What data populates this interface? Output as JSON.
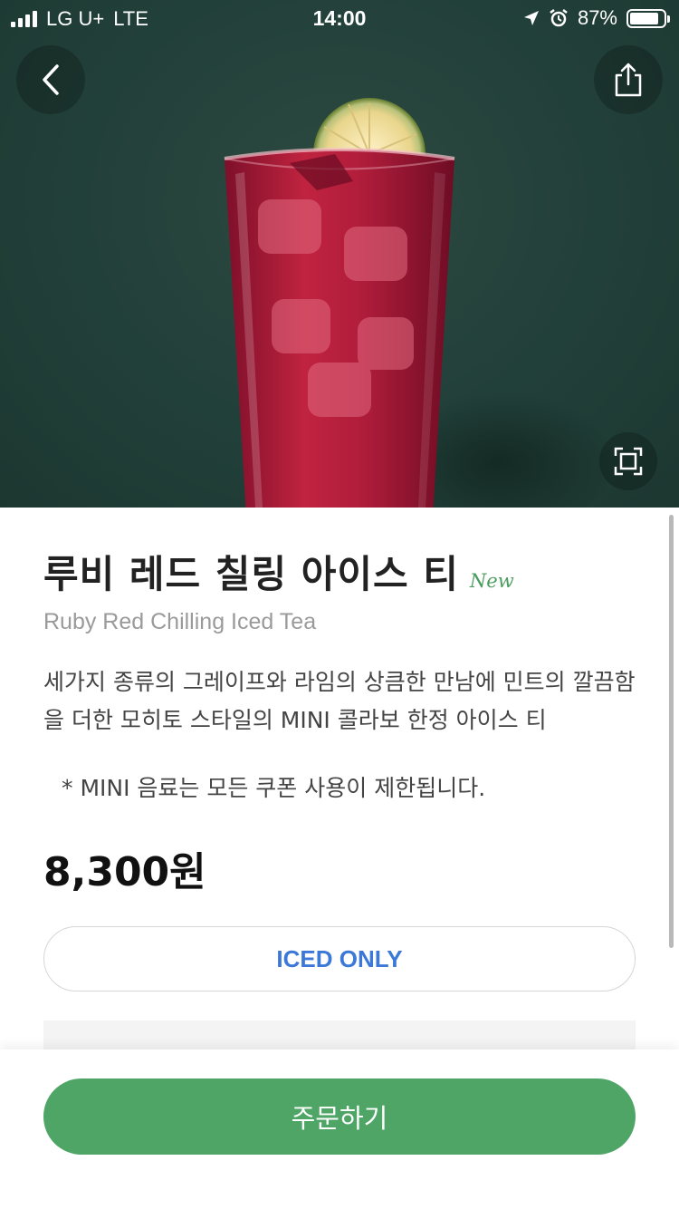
{
  "status_bar": {
    "carrier": "LG U+",
    "network": "LTE",
    "time": "14:00",
    "battery": "87%",
    "battery_level": 0.87,
    "icons": [
      "location-arrow-icon",
      "alarm-icon",
      "battery-icon"
    ]
  },
  "header": {
    "back_icon": "chevron-left-icon",
    "share_icon": "share-icon",
    "zoom_icon": "fullscreen-icon"
  },
  "product": {
    "name_ko": "루비 레드 칠링 아이스 티",
    "badge": "New",
    "name_en": "Ruby Red Chilling Iced Tea",
    "description": "세가지 종류의 그레이프와 라임의 상큼한 만남에 민트의 깔끔함을 더한 모히토 스타일의 MINI 콜라보 한정 아이스 티",
    "note": "* MINI 음료는 모든 쿠폰 사용이 제한됩니다.",
    "price": "8,300원",
    "temperature_option": "ICED ONLY"
  },
  "actions": {
    "order_label": "주문하기"
  },
  "colors": {
    "hero_background": "#22403a",
    "accent_green": "#4ea566",
    "new_badge": "#4a9d5e",
    "iced_text": "#3c78d8"
  }
}
